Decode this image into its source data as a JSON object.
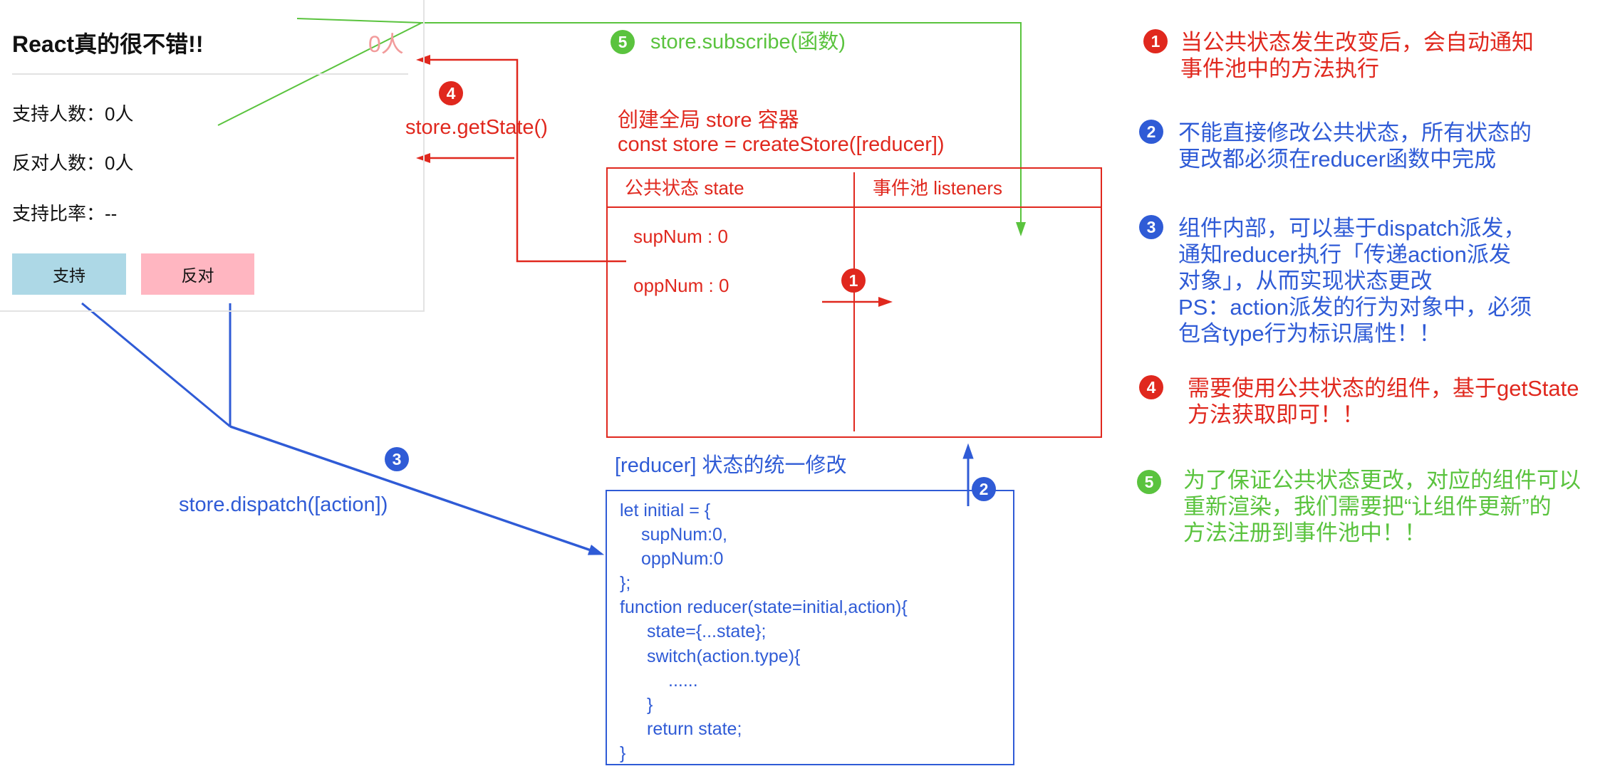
{
  "colors": {
    "red": "#e0281e",
    "blue": "#2f5bd6",
    "green": "#5ac33e",
    "support_button": "#add8e6",
    "oppose_button": "#ffb6c1",
    "total_count": "#f29b9b"
  },
  "component": {
    "title": "React真的很不错!!",
    "total": "0人",
    "stats": [
      {
        "label": "支持人数：",
        "value": "0人"
      },
      {
        "label": "反对人数：",
        "value": "0人"
      },
      {
        "label": "支持比率：",
        "value": "--"
      }
    ],
    "support_button": "支持",
    "oppose_button": "反对"
  },
  "flow": {
    "notify": {
      "badge": "1"
    },
    "reducer_update": {
      "badge": "2"
    },
    "dispatch": {
      "badge": "3",
      "label": "store.dispatch([action])"
    },
    "get_state": {
      "badge": "4",
      "label": "store.getState()"
    },
    "subscribe": {
      "badge": "5",
      "label": "store.subscribe(函数)"
    }
  },
  "store": {
    "caption": "创建全局 store 容器",
    "create_code": "const store = createStore([reducer])",
    "state_header": "公共状态 state",
    "listeners_header": "事件池 listeners",
    "state_items": [
      "supNum : 0",
      "oppNum : 0"
    ]
  },
  "reducer": {
    "title": "[reducer] 状态的统一修改",
    "code_lines": [
      "let initial = {",
      "supNum:0,",
      "oppNum:0",
      "};",
      "function reducer(state=initial,action){",
      "state={...state};",
      "switch(action.type){",
      "......",
      "}",
      "return state;",
      "}"
    ]
  },
  "notes": [
    {
      "badge": "1",
      "lines": [
        "当公共状态发生改变后，会自动通知",
        "事件池中的方法执行"
      ]
    },
    {
      "badge": "2",
      "lines": [
        "不能直接修改公共状态，所有状态的",
        "更改都必须在reducer函数中完成"
      ]
    },
    {
      "badge": "3",
      "lines": [
        "组件内部，可以基于dispatch派发，",
        "通知reducer执行「传递action派发",
        "对象」，从而实现状态更改",
        "PS：action派发的行为对象中，必须",
        "包含type行为标识属性！！"
      ]
    },
    {
      "badge": "4",
      "lines": [
        "需要使用公共状态的组件，基于getState",
        "方法获取即可！！"
      ]
    },
    {
      "badge": "5",
      "lines": [
        "为了保证公共状态更改，对应的组件可以",
        "重新渲染，我们需要把“让组件更新”的",
        "方法注册到事件池中！！"
      ]
    }
  ]
}
